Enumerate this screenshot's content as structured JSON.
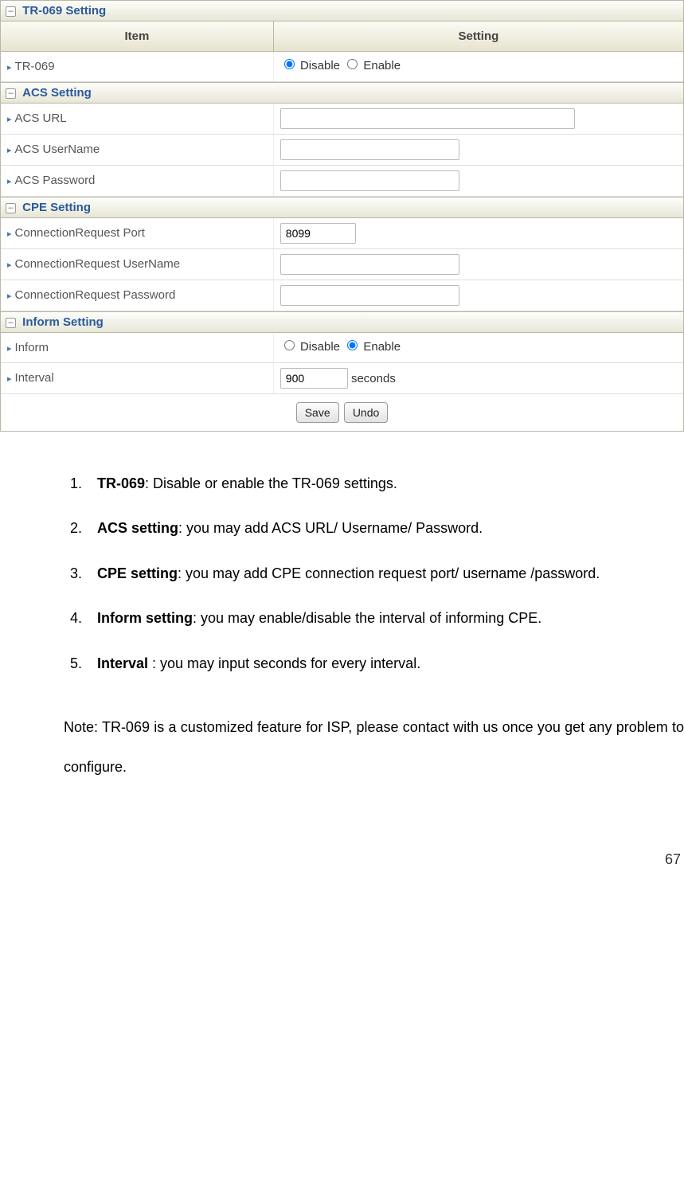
{
  "sections": {
    "tr069": {
      "title": "TR-069 Setting"
    },
    "acs": {
      "title": "ACS Setting"
    },
    "cpe": {
      "title": "CPE Setting"
    },
    "inform": {
      "title": "Inform Setting"
    }
  },
  "headers": {
    "item": "Item",
    "setting": "Setting"
  },
  "rows": {
    "tr069": {
      "label": "TR-069",
      "disable": "Disable",
      "enable": "Enable",
      "selected": "disable"
    },
    "acs_url": {
      "label": "ACS URL",
      "value": ""
    },
    "acs_user": {
      "label": "ACS UserName",
      "value": ""
    },
    "acs_pass": {
      "label": "ACS Password",
      "value": ""
    },
    "cpe_port": {
      "label": "ConnectionRequest Port",
      "value": "8099"
    },
    "cpe_user": {
      "label": "ConnectionRequest UserName",
      "value": ""
    },
    "cpe_pass": {
      "label": "ConnectionRequest Password",
      "value": ""
    },
    "inform": {
      "label": "Inform",
      "disable": "Disable",
      "enable": "Enable",
      "selected": "enable"
    },
    "interval": {
      "label": "Interval",
      "value": "900",
      "unit": "seconds"
    }
  },
  "buttons": {
    "save": "Save",
    "undo": "Undo"
  },
  "doc": {
    "items": [
      {
        "b": "TR-069",
        "t": ": Disable or enable the TR-069 settings."
      },
      {
        "b": "ACS setting",
        "t": ": you may add ACS URL/ Username/ Password."
      },
      {
        "b": "CPE setting",
        "t": ": you may add CPE connection request port/ username /password."
      },
      {
        "b": "Inform setting",
        "t": ": you may enable/disable the interval of informing CPE."
      },
      {
        "b": "Interval ",
        "t": ": you may input seconds for every interval."
      }
    ],
    "note": "Note: TR-069 is a customized feature for ISP, please contact with us once you get any problem to configure."
  },
  "page": "67"
}
